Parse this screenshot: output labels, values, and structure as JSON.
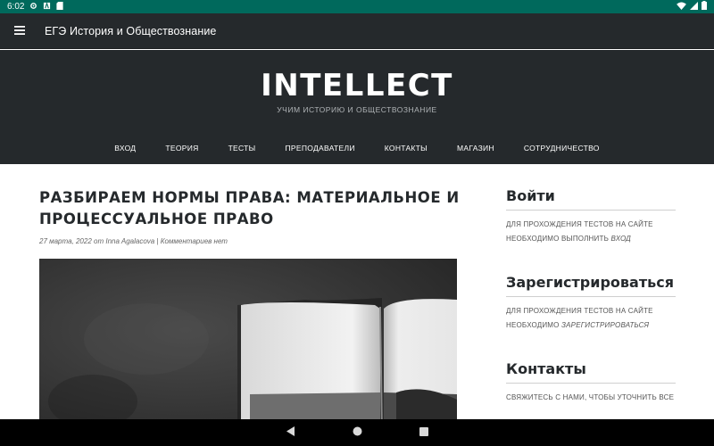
{
  "status_bar": {
    "time": "6:02"
  },
  "app_bar": {
    "title": "ЕГЭ История и Обществознание"
  },
  "site": {
    "brand": "INTELLECT",
    "tagline": "УЧИМ ИСТОРИЮ И ОБЩЕСТВОЗНАНИЕ",
    "nav": [
      "ВХОД",
      "ТЕОРИЯ",
      "ТЕСТЫ",
      "ПРЕПОДАВАТЕЛИ",
      "КОНТАКТЫ",
      "МАГАЗИН",
      "СОТРУДНИЧЕСТВО"
    ]
  },
  "article": {
    "title_line1": "РАЗБИРАЕМ НОРМЫ ПРАВА: МАТЕРИАЛЬНОЕ И",
    "title_line2": "ПРОЦЕССУАЛЬНОЕ ПРАВО",
    "date": "27 марта, 2022",
    "by": "от",
    "author": "Inna Agalacova",
    "separator": "|",
    "comments": "Комментариев нет"
  },
  "sidebar": {
    "login": {
      "title": "Войти",
      "text_line1": "ДЛЯ ПРОХОЖДЕНИЯ ТЕСТОВ НА САЙТЕ",
      "text_line2": "НЕОБХОДИМО ВЫПОЛНИТЬ",
      "link": "ВХОД"
    },
    "register": {
      "title": "Зарегистрироваться",
      "text_line1": "ДЛЯ ПРОХОЖДЕНИЯ ТЕСТОВ НА САЙТЕ",
      "text_line2": "НЕОБХОДИМО",
      "link": "ЗАРЕГИСТРИРОВАТЬСЯ"
    },
    "contacts": {
      "title": "Контакты",
      "text_line1": "СВЯЖИТЕСЬ С НАМИ, ЧТОБЫ УТОЧНИТЬ ВСЕ"
    }
  },
  "colors": {
    "status_bar": "#00695c",
    "header": "#25292c",
    "nav_bar": "#000000"
  }
}
